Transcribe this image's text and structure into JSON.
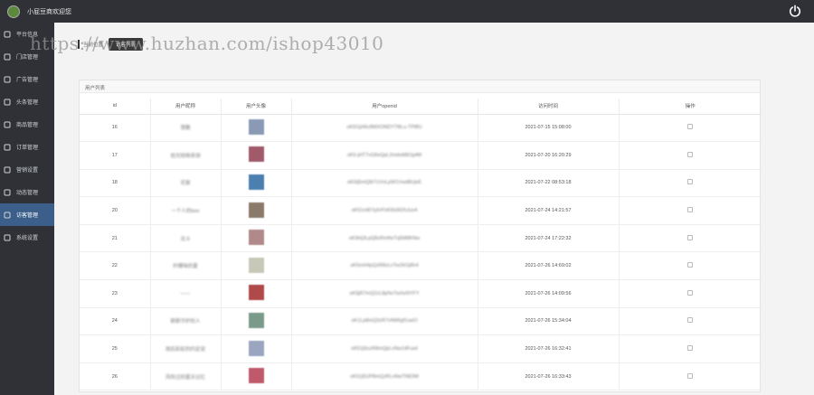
{
  "header": {
    "app_title": "小屁豆商欢迎您"
  },
  "sidebar": {
    "items": [
      {
        "label": "平台信息",
        "icon": "monitor-icon",
        "active": false
      },
      {
        "label": "门店管理",
        "icon": "store-icon",
        "active": false
      },
      {
        "label": "广告管理",
        "icon": "ad-icon",
        "active": false
      },
      {
        "label": "头条管理",
        "icon": "news-icon",
        "active": false
      },
      {
        "label": "商品管理",
        "icon": "cart-icon",
        "active": false
      },
      {
        "label": "订单管理",
        "icon": "order-icon",
        "active": false
      },
      {
        "label": "营销设置",
        "icon": "marketing-icon",
        "active": false
      },
      {
        "label": "动态管理",
        "icon": "feed-icon",
        "active": false
      },
      {
        "label": "访客管理",
        "icon": "user-icon",
        "active": true
      },
      {
        "label": "系统设置",
        "icon": "gear-icon",
        "active": false
      }
    ]
  },
  "breadcrumb": {
    "label": "当前位置",
    "tab": "访客列表"
  },
  "watermark": "https://www.huzhan.com/ishop43010",
  "panel": {
    "title": "用户列表"
  },
  "table": {
    "headers": [
      "id",
      "用户昵称",
      "用户头像",
      "用户openid",
      "访问时间",
      "操作"
    ],
    "rows": [
      {
        "id": "16",
        "nickname": "慧鹏",
        "openid": "oK5I1jH6c8MXONDYTBLu-TP8fU",
        "time": "2021-07-15 15:08:00",
        "avatar_color": "#8a9ab5"
      },
      {
        "id": "17",
        "nickname": "拾光知晓亲测",
        "openid": "oK5-jHT7vG8xQpL2mdxABOg4M",
        "time": "2021-07-20 16:20:29",
        "avatar_color": "#a05a6a"
      },
      {
        "id": "18",
        "nickname": "花絮",
        "openid": "oK5Ij5mQ8rTzVnLpW1Vwd8UjeE",
        "time": "2021-07-22 08:53:18",
        "avatar_color": "#4a7fb0"
      },
      {
        "id": "20",
        "nickname": "一个人的bee",
        "openid": "oK51mB7qXrPzKl9sW2hJuv4",
        "time": "2021-07-24 14:21:57",
        "avatar_color": "#8b7a6a"
      },
      {
        "id": "21",
        "nickname": "北斗",
        "openid": "oK9Hj3LpQ8zRmNvTq5M8KNw",
        "time": "2021-07-24 17:22:32",
        "avatar_color": "#b08a8a"
      },
      {
        "id": "22",
        "nickname": "柠檬味的夏",
        "openid": "oK5mH4pQzR8vLnTw2KGjRr4",
        "time": "2021-07-26 14:69:02",
        "avatar_color": "#c8c8b8"
      },
      {
        "id": "23",
        "nickname": "——",
        "openid": "oK5jR7mQ2zL8pNvTwXeNYFY",
        "time": "2021-07-26 14:09:56",
        "avatar_color": "#b04a4a"
      },
      {
        "id": "24",
        "nickname": "默默守护的人",
        "openid": "oK1Lp8mQ3zR7vNtWgf1uwO",
        "time": "2021-07-26 15:34:04",
        "avatar_color": "#7a9a8a"
      },
      {
        "id": "25",
        "nickname": "雨后彩虹的约定说",
        "openid": "oK51j5ozR8mQpLvNw14FuwI",
        "time": "2021-07-26 16:32:41",
        "avatar_color": "#9aa6c0"
      },
      {
        "id": "26",
        "nickname": "风吹过的夏天记忆",
        "openid": "oK51j5UP8mQzRLvNwTNE5M",
        "time": "2021-07-26 16:33:43",
        "avatar_color": "#c05a6a"
      }
    ]
  }
}
